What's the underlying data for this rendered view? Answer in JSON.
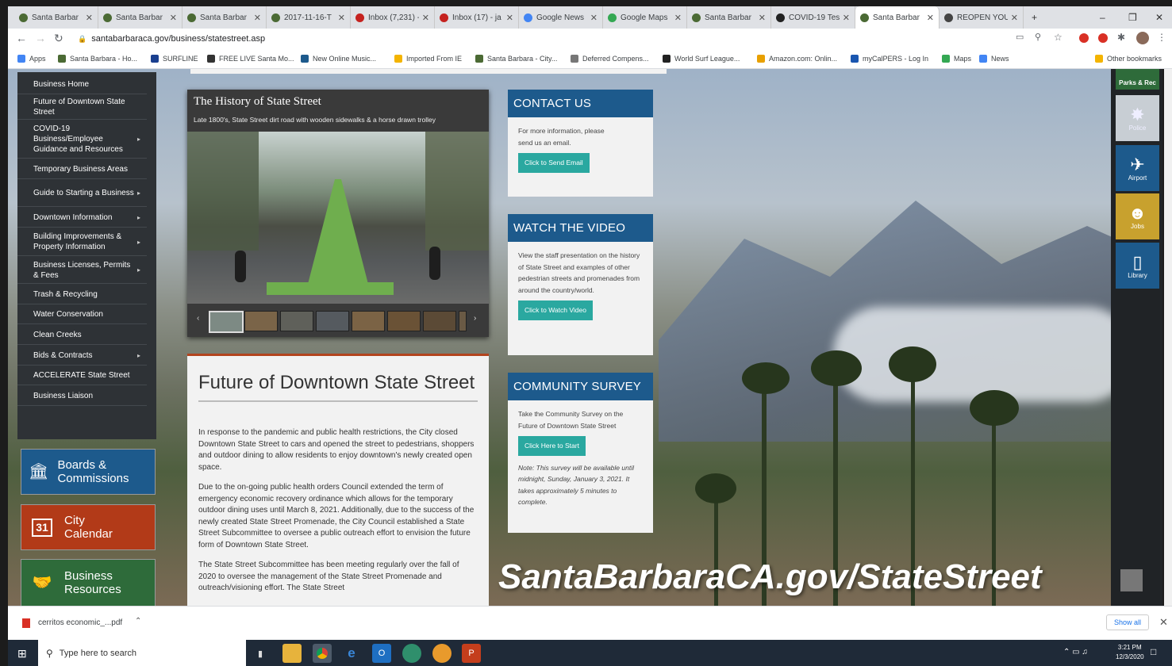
{
  "browser": {
    "tabs": [
      {
        "title": "Santa Barbar",
        "color": "#4b6a34"
      },
      {
        "title": "Santa Barbar",
        "color": "#4b6a34"
      },
      {
        "title": "Santa Barbar",
        "color": "#4b6a34"
      },
      {
        "title": "2017-11-16-T",
        "color": "#4b6a34"
      },
      {
        "title": "Inbox (7,231) -",
        "color": "#c5221f"
      },
      {
        "title": "Inbox (17) - ja",
        "color": "#c5221f"
      },
      {
        "title": "Google News",
        "color": "#4285f4"
      },
      {
        "title": "Google Maps",
        "color": "#34a853"
      },
      {
        "title": "Santa Barbar",
        "color": "#4b6a34"
      },
      {
        "title": "COVID-19 Tes",
        "color": "#222222"
      },
      {
        "title": "Santa Barbar",
        "color": "#4b6a34"
      },
      {
        "title": "REOPEN YOU",
        "color": "#444444"
      }
    ],
    "url": "santabarbaraca.gov/business/statestreet.asp",
    "bookmarks": [
      "Apps",
      "Santa Barbara - Ho...",
      "SURFLINE",
      "FREE LIVE Santa Mo...",
      "New Online Music...",
      "Imported From IE",
      "Santa Barbara - City...",
      "Deferred Compens...",
      "World Surf League...",
      "Amazon.com: Onlin...",
      "myCalPERS - Log In",
      "Maps",
      "News"
    ],
    "other_bookmarks": "Other bookmarks"
  },
  "sidebar": {
    "items": [
      {
        "label": "Business Home",
        "arrow": false
      },
      {
        "label": "Future of Downtown State Street",
        "arrow": false
      },
      {
        "label": "COVID-19 Business/Employee Guidance and Resources",
        "arrow": true
      },
      {
        "label": "Temporary Business Areas",
        "arrow": false
      },
      {
        "label": "Guide to Starting a Business",
        "arrow": true
      },
      {
        "label": "Downtown Information",
        "arrow": true
      },
      {
        "label": "Building Improvements & Property Information",
        "arrow": true
      },
      {
        "label": "Business Licenses, Permits & Fees",
        "arrow": true
      },
      {
        "label": "Trash & Recycling",
        "arrow": false
      },
      {
        "label": "Water Conservation",
        "arrow": false
      },
      {
        "label": "Clean Creeks",
        "arrow": false
      },
      {
        "label": "Bids & Contracts",
        "arrow": true
      },
      {
        "label": "ACCELERATE State Street",
        "arrow": false
      },
      {
        "label": "Business Liaison",
        "arrow": false
      }
    ]
  },
  "quicklinks": {
    "boards": "Boards & Commissions",
    "calendar": "City Calendar",
    "calendar_num": "31",
    "business": "Business Resources"
  },
  "gallery": {
    "title": "The History of State Street",
    "caption": "Late 1800's, State Street dirt road with wooden sidewalks & a horse drawn trolley"
  },
  "article": {
    "title": "Future of Downtown State Street",
    "p1": "In response to the pandemic and public health restrictions, the City closed Downtown State Street to cars and opened the street to pedestrians, shoppers and outdoor dining to allow residents to enjoy downtown's newly created open space.",
    "p2": "Due to the on-going public health orders Council extended the term of emergency economic recovery ordinance which allows for the temporary outdoor dining uses until March 8, 2021. Additionally, due to the success of the newly created State Street Promenade, the City Council established a State Street Subcommittee to oversee a public outreach effort to envision the future form of Downtown State Street.",
    "p3": "The State Street Subcommittee has been meeting regularly over the fall of 2020 to oversee the management of the State Street Promenade and outreach/visioning effort. The State Street"
  },
  "contact": {
    "title": "CONTACT US",
    "text": "For more information, please send us an email.",
    "button": "Click to Send Email"
  },
  "video": {
    "title": "WATCH THE VIDEO",
    "text": "View the staff presentation on the history of State Street and examples of other pedestrian streets and promenades from around the country/world.",
    "button": "Click to Watch Video"
  },
  "survey": {
    "title": "COMMUNITY SURVEY",
    "text": "Take the Community Survey on the Future of Downtown State Street",
    "button": "Click Here to Start",
    "note": "Note: This survey will be available until midnight, Sunday, January 3, 2021. It takes approximately 5 minutes to complete."
  },
  "right_links": {
    "parks": "Parks & Rec",
    "police": "Police",
    "airport": "Airport",
    "jobs": "Jobs",
    "library": "Library"
  },
  "overlay_url": "SantaBarbaraCA.gov/StateStreet",
  "download": {
    "file": "cerritos economic_...pdf",
    "show_all": "Show all"
  },
  "taskbar": {
    "search": "Type here to search",
    "time": "3:21 PM",
    "date": "12/3/2020"
  }
}
